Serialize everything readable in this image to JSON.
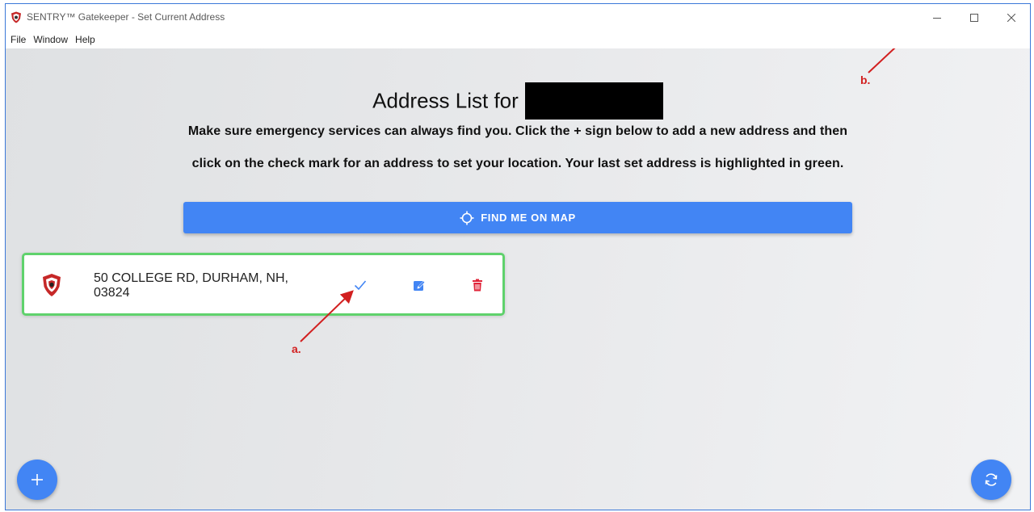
{
  "window": {
    "title": "SENTRY™ Gatekeeper - Set Current Address"
  },
  "menu": [
    "File",
    "Window",
    "Help"
  ],
  "page": {
    "heading": "Address List for",
    "description_line1": "Make sure emergency services can always find you. Click the + sign below to add a new address and then",
    "description_line2": "click on the check mark for an address to set your location. Your last set address is highlighted in green.",
    "find_button_label": "FIND ME ON MAP"
  },
  "addresses": [
    {
      "line1": "50 COLLEGE RD, DURHAM, NH,",
      "line2": "03824",
      "selected": true
    }
  ],
  "annotations": {
    "a": "a.",
    "b": "b."
  },
  "colors": {
    "accent_blue": "#4285f4",
    "selected_border": "#5fd26c",
    "delete_red": "#e0243a",
    "annotation_red": "#d21f1f"
  },
  "icons": {
    "app": "sentry-shield-icon",
    "find": "crosshair-icon",
    "check": "check-icon",
    "edit": "edit-icon",
    "delete": "trash-icon",
    "add": "plus-icon",
    "refresh": "refresh-icon"
  }
}
